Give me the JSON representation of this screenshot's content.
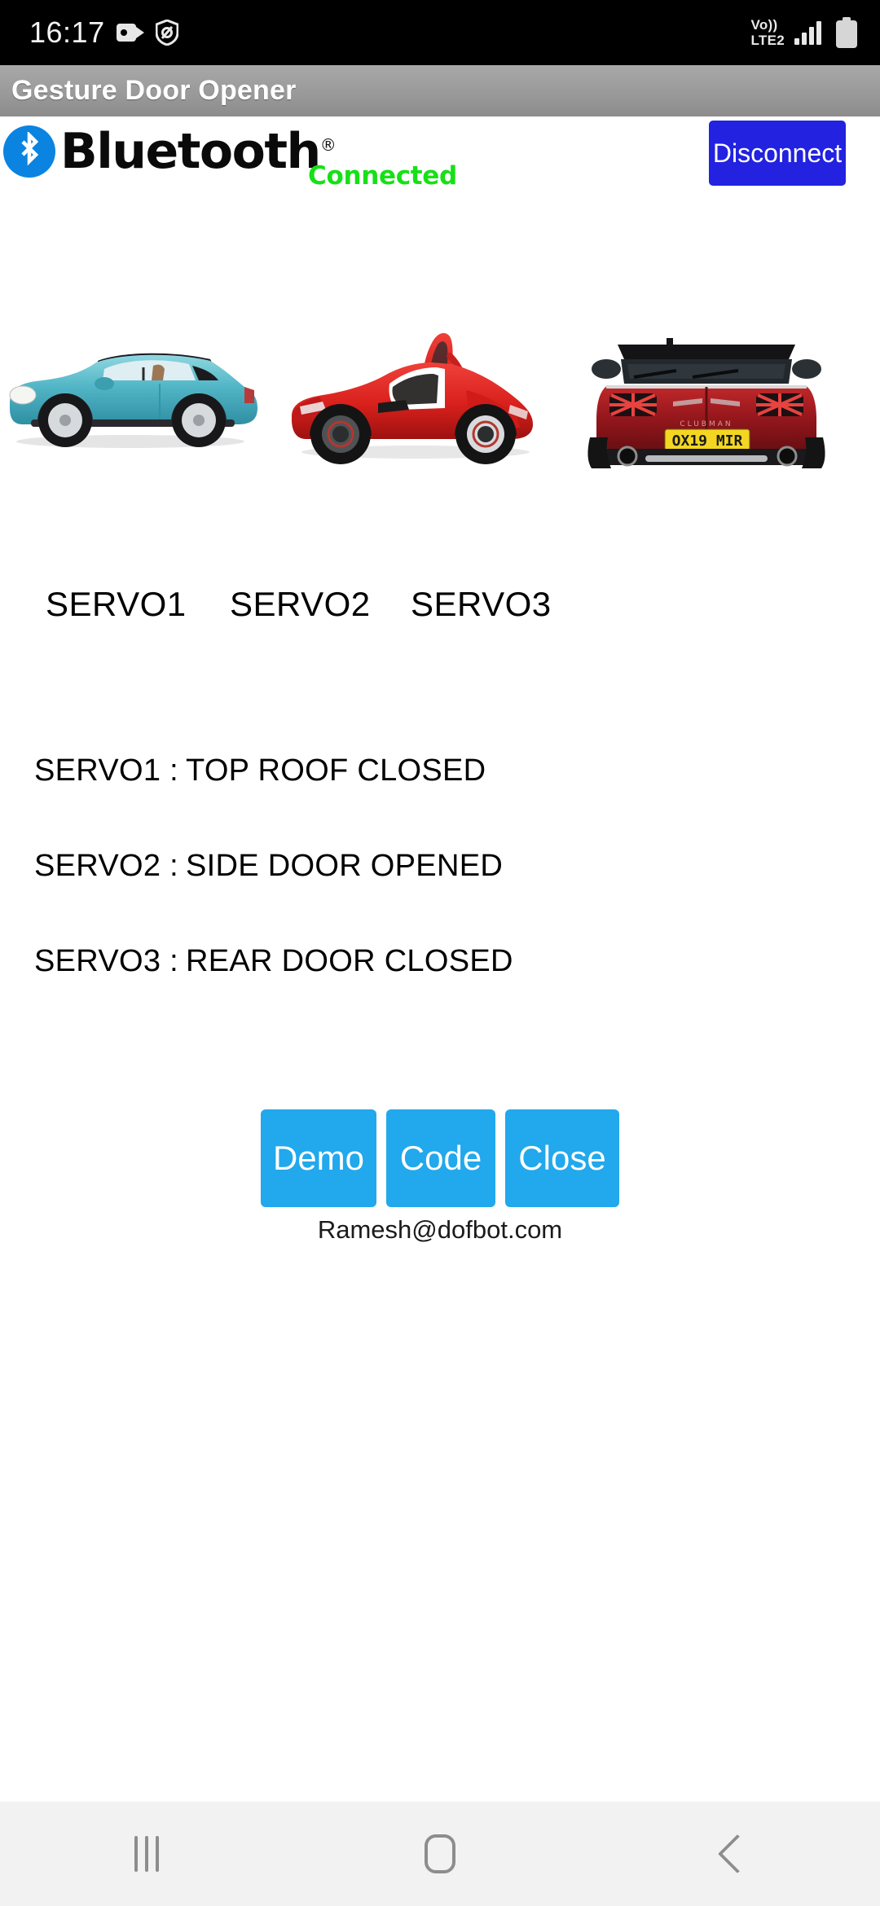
{
  "status_bar": {
    "clock": "16:17",
    "icons_left": [
      "screen-recorder-icon",
      "do-not-disturb-icon"
    ],
    "network_label_top": "Vo))",
    "network_label_bottom": "LTE2",
    "icons_right": [
      "signal-bars-icon",
      "battery-icon"
    ]
  },
  "app": {
    "title": "Gesture Door Opener"
  },
  "bluetooth": {
    "wordmark": "Bluetooth",
    "registered_mark": "®",
    "status": "Connected",
    "status_color": "#16e016",
    "disconnect_label": "Disconnect",
    "disconnect_color": "#2222e0"
  },
  "servos": {
    "labels": [
      "SERVO1",
      "SERVO2",
      "SERVO3"
    ],
    "images": [
      {
        "name": "mini-convertible-side-view",
        "alt": "Teal Mini convertible, side view, roof closed"
      },
      {
        "name": "sports-car-door-open",
        "alt": "Red sports car with butterfly door opened"
      },
      {
        "name": "mini-clubman-rear-view",
        "alt": "Red Mini Clubman rear view",
        "plate": "OX19 MIR"
      }
    ]
  },
  "status_rows": [
    {
      "key": "SERVO1 :",
      "value": "TOP ROOF CLOSED"
    },
    {
      "key": "SERVO2 :",
      "value": "SIDE DOOR OPENED"
    },
    {
      "key": "SERVO3 :",
      "value": "REAR DOOR CLOSED"
    }
  ],
  "actions": {
    "demo_label": "Demo",
    "code_label": "Code",
    "close_label": "Close",
    "button_color": "#22a8ec"
  },
  "footer": {
    "email": "Ramesh@dofbot.com"
  },
  "navbar": {
    "recents": "recents-icon",
    "home": "home-icon",
    "back": "back-icon"
  }
}
